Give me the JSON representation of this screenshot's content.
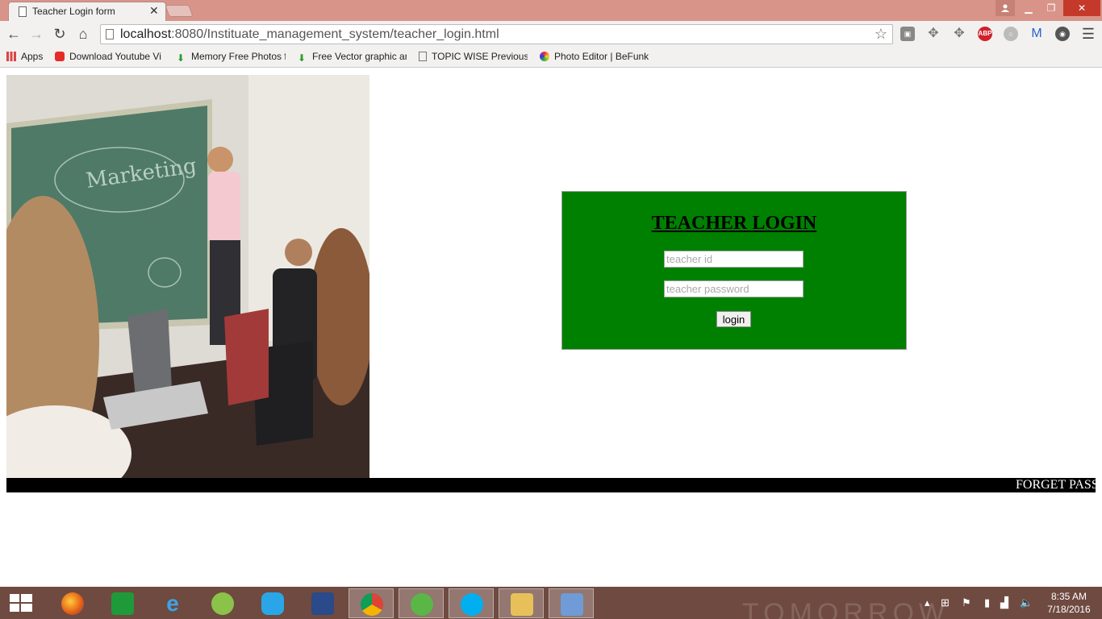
{
  "browser": {
    "tab_title": "Teacher Login form",
    "url_host": "localhost",
    "url_rest": ":8080/Instituate_management_system/teacher_login.html",
    "bookmarks": [
      {
        "label": "Apps"
      },
      {
        "label": "Download Youtube Vi"
      },
      {
        "label": "Memory Free Photos f"
      },
      {
        "label": "Free Vector graphic ar"
      },
      {
        "label": "TOPIC WISE Previous"
      },
      {
        "label": "Photo Editor | BeFunk"
      }
    ]
  },
  "login": {
    "title": "TEACHER LOGIN",
    "id_placeholder": "teacher id",
    "password_placeholder": "teacher password",
    "button_label": "login"
  },
  "marquee": {
    "text": "FORGET PASS"
  },
  "taskbar": {
    "time": "8:35 AM",
    "date": "7/18/2016",
    "wallpaper_text": "TOMORROW"
  },
  "colors": {
    "login_box": "#008000",
    "titlebar": "#d9948a",
    "taskbar": "#6f4a40"
  }
}
